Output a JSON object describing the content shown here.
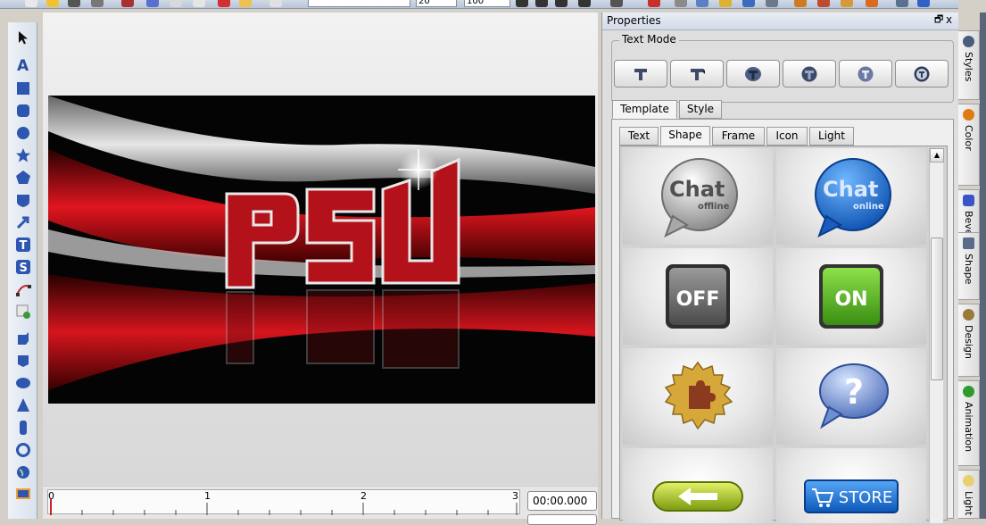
{
  "properties": {
    "title": "Properties",
    "float_glyph": "🗗",
    "close_glyph": "x",
    "text_mode": {
      "label": "Text Mode",
      "buttons": [
        "text-mode-1",
        "text-mode-2",
        "text-mode-3",
        "text-mode-4",
        "text-mode-5",
        "text-mode-6"
      ]
    },
    "tabs": [
      {
        "label": "Template"
      },
      {
        "label": "Style"
      }
    ],
    "subtabs": [
      {
        "label": "Text"
      },
      {
        "label": "Shape"
      },
      {
        "label": "Frame"
      },
      {
        "label": "Icon"
      },
      {
        "label": "Light"
      }
    ],
    "gallery": {
      "chat_grey": {
        "title": "Chat",
        "sub": "offline"
      },
      "chat_blue": {
        "title": "Chat",
        "sub": "online"
      },
      "off_button": "OFF",
      "on_button": "ON",
      "question": "?",
      "store_button": "STORE"
    }
  },
  "side_tabs": [
    {
      "label": "Styles",
      "icon": "styles-icon",
      "color": "#4b5d7d"
    },
    {
      "label": "Color",
      "icon": "color-icon",
      "color": "#e07a12"
    },
    {
      "label": "Bevel",
      "icon": "bevel-icon",
      "color": "#3a54c8"
    },
    {
      "label": "Shape",
      "icon": "shape-icon",
      "color": "#5a6a8a"
    },
    {
      "label": "Design",
      "icon": "design-icon",
      "color": "#9a7a3a"
    },
    {
      "label": "Animation",
      "icon": "animation-icon",
      "color": "#2f9a2f"
    },
    {
      "label": "Light",
      "icon": "light-icon",
      "color": "#e8d070"
    }
  ],
  "canvas": {
    "logo_text": "PSU"
  },
  "timeline": {
    "ticks": [
      "0",
      "1",
      "2",
      "3"
    ],
    "time": "00:00.000"
  },
  "toolbar": {
    "font_size": "20",
    "zoom": "100"
  },
  "colors": {
    "accent_red": "#c8141e",
    "panel_bg": "#dedede",
    "chat_blue": "#1d74d8",
    "on_green": "#4fb31c"
  }
}
